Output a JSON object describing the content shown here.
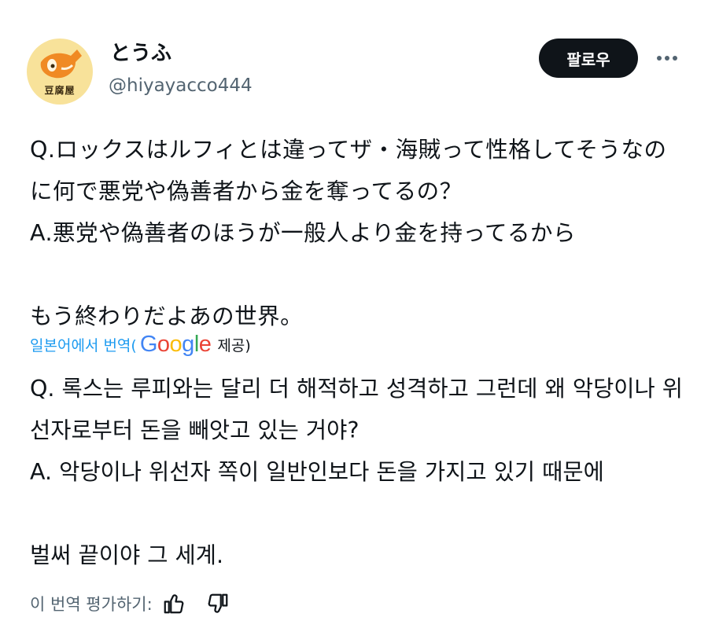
{
  "author": {
    "display_name": "とうふ",
    "handle": "@hiyayacco444",
    "avatar_text": "豆腐屋"
  },
  "actions": {
    "follow_label": "팔로우",
    "more_icon": "more-horizontal-icon"
  },
  "post": {
    "text": "Q.ロックスはルフィとは違ってザ・海賊って性格してそうなのに何で悪党や偽善者から金を奪ってるの？\nA.悪党や偽善者のほうが一般人より金を持ってるから\n\nもう終わりだよあの世界。"
  },
  "translation": {
    "source_label": "일본어에서 번역(",
    "provider": "Google",
    "provider_suffix": "제공)",
    "text": "Q. 록스는 루피와는 달리 더 해적하고 성격하고 그런데 왜 악당이나 위선자로부터 돈을 빼앗고 있는 거야?\nA. 악당이나 위선자 쪽이 일반인보다 돈을 가지고 있기 때문에\n\n벌써 끝이야 그 세계.",
    "rate_label": "이 번역 평가하기:"
  },
  "colors": {
    "google_blue": "#4285F4",
    "google_red": "#EA4335",
    "google_yellow": "#FBBC05",
    "google_green": "#34A853",
    "link": "#1d9bf0"
  }
}
